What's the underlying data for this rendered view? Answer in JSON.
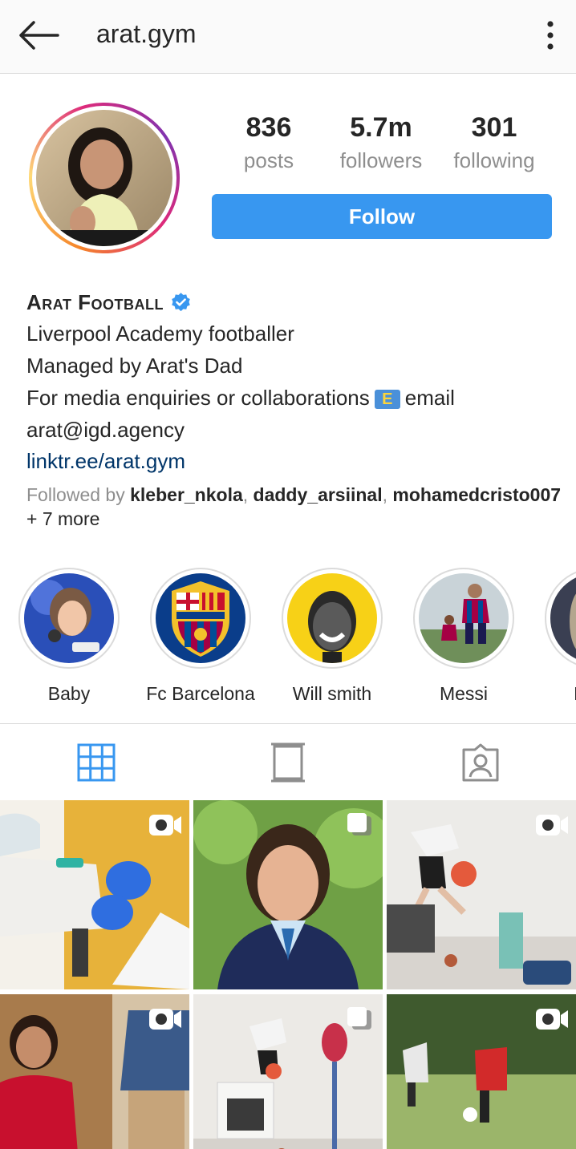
{
  "header": {
    "username": "arat.gym"
  },
  "profile": {
    "stats": [
      {
        "value": "836",
        "label": "posts"
      },
      {
        "value": "5.7m",
        "label": "followers"
      },
      {
        "value": "301",
        "label": "following"
      }
    ],
    "follow_label": "Follow",
    "display_name": "Arat Football",
    "verified": true,
    "bio_lines": [
      "Liverpool Academy footballer",
      "Managed by Arat's Dad"
    ],
    "bio_email_prefix": "For media enquiries or collaborations",
    "bio_email_emoji": "E",
    "bio_email_suffix": "email",
    "email": "arat@igd.agency",
    "link": "linktr.ee/arat.gym",
    "followed_by_prefix": "Followed by",
    "followed_by_users": [
      "kleber_nkola",
      "daddy_arsiinal",
      "mohamedcristo007"
    ],
    "followed_by_more": "+ 7 more"
  },
  "highlights": [
    {
      "label": "Baby"
    },
    {
      "label": "Fc Barcelona"
    },
    {
      "label": "Will smith"
    },
    {
      "label": "Messi"
    },
    {
      "label": "Nova"
    }
  ],
  "tabs": [
    {
      "icon": "grid-icon",
      "active": true
    },
    {
      "icon": "igtv-icon",
      "active": false
    },
    {
      "icon": "tagged-icon",
      "active": false
    }
  ],
  "posts": [
    {
      "type": "video",
      "icon": "video-icon"
    },
    {
      "type": "carousel",
      "icon": "carousel-icon"
    },
    {
      "type": "video",
      "icon": "video-icon"
    },
    {
      "type": "video",
      "icon": "video-icon"
    },
    {
      "type": "carousel",
      "icon": "carousel-icon"
    },
    {
      "type": "video",
      "icon": "video-icon"
    }
  ],
  "colors": {
    "accent": "#3897f0",
    "link": "#003569",
    "muted": "#8e8e8e",
    "text": "#262626"
  }
}
